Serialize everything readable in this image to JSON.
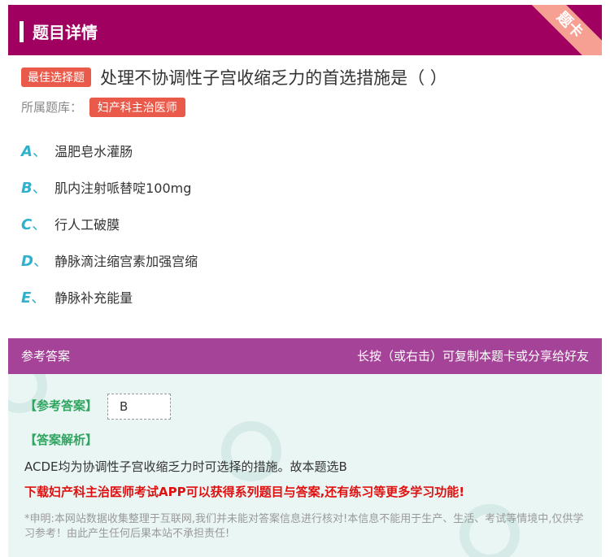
{
  "header": {
    "title": "题目详情",
    "ribbon": "题卡"
  },
  "question": {
    "type_tag": "最佳选择题",
    "text": "处理不协调性子宫收缩乏力的首选措施是（ ）",
    "bank_label": "所属题库：",
    "bank_name": "妇产科主治医师"
  },
  "options": [
    {
      "letter": "A",
      "sep": "、",
      "text": "温肥皂水灌肠"
    },
    {
      "letter": "B",
      "sep": "、",
      "text": "肌内注射哌替啶100mg"
    },
    {
      "letter": "C",
      "sep": "、",
      "text": "行人工破膜"
    },
    {
      "letter": "D",
      "sep": "、",
      "text": "静脉滴注缩宫素加强宫缩"
    },
    {
      "letter": "E",
      "sep": "、",
      "text": "静脉补充能量"
    }
  ],
  "answer_section": {
    "title": "参考答案",
    "hint": "长按（或右击）可复制本题卡或分享给好友",
    "answer_label": "【参考答案】",
    "answer_value": "B",
    "analysis_label": "【答案解析】",
    "analysis_text": "ACDE均为协调性子宫收缩乏力时可选择的措施。故本题选B",
    "promo": "下载妇产科主治医师考试APP可以获得系列题目与答案,还有练习等更多学习功能!",
    "disclaimer": "*申明:本网站数据收集整理于互联网,我们并未能对答案信息进行核对!本信息不能用于生产、生活、考试等情境中,仅供学习参考！由此产生任何后果本站不承担责任!"
  },
  "colors": {
    "header": "#a0005f",
    "accent": "#e95a4a",
    "answer_head": "#a54398",
    "answer_bg": "#eaf6f4",
    "option_letter": "#2fb0cc"
  }
}
